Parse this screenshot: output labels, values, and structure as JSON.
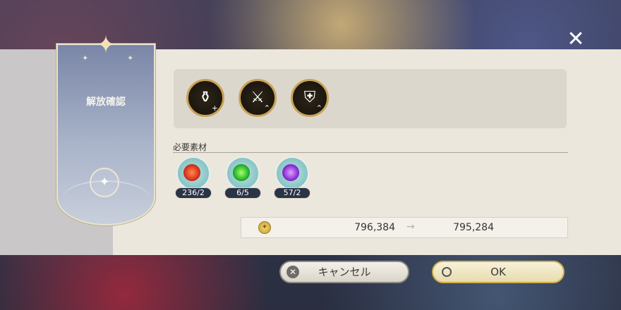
{
  "background": {
    "title_text": ""
  },
  "close": {
    "icon": "close-icon"
  },
  "banner": {
    "title": "解放確認",
    "star_icon": "star-icon",
    "emblem_icon": "star-emblem-icon"
  },
  "skills": [
    {
      "icon": "pot-icon",
      "glyph": "⚗",
      "sub": "+"
    },
    {
      "icon": "sword-icon",
      "glyph": "🗡",
      "sub": "⌃"
    },
    {
      "icon": "shield-icon",
      "glyph": "🛡",
      "sub": "⌃"
    }
  ],
  "materials": {
    "title": "必要素材",
    "items": [
      {
        "color": "#d8321a",
        "count": "236/2"
      },
      {
        "color": "#24b528",
        "count": "6/5"
      },
      {
        "color": "#8a2fd6",
        "count": "57/2"
      }
    ]
  },
  "gold": {
    "icon": "gold-coin-icon",
    "before": "796,384",
    "after": "795,284"
  },
  "buttons": {
    "cancel": "キャンセル",
    "ok": "OK"
  }
}
